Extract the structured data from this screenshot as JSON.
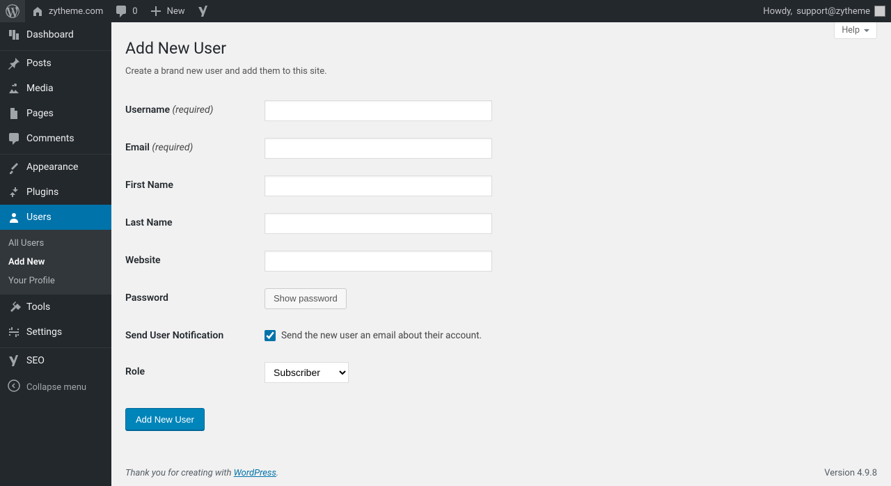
{
  "adminbar": {
    "site_name": "zytheme.com",
    "comments_count": "0",
    "new_label": "New",
    "howdy_prefix": "Howdy,",
    "user_name": "support@zytheme"
  },
  "sidebar": {
    "dashboard": "Dashboard",
    "posts": "Posts",
    "media": "Media",
    "pages": "Pages",
    "comments": "Comments",
    "appearance": "Appearance",
    "plugins": "Plugins",
    "users": "Users",
    "tools": "Tools",
    "settings": "Settings",
    "seo": "SEO",
    "collapse": "Collapse menu",
    "users_sub": {
      "all": "All Users",
      "add": "Add New",
      "profile": "Your Profile"
    }
  },
  "screen": {
    "help": "Help"
  },
  "page": {
    "title": "Add New User",
    "intro": "Create a brand new user and add them to this site."
  },
  "form": {
    "username": "Username",
    "email": "Email",
    "required": "(required)",
    "first_name": "First Name",
    "last_name": "Last Name",
    "website": "Website",
    "password": "Password",
    "show_password": "Show password",
    "notification": "Send User Notification",
    "notification_desc": "Send the new user an email about their account.",
    "role": "Role",
    "role_value": "Subscriber",
    "submit": "Add New User"
  },
  "footer": {
    "thanks_pre": "Thank you for creating with ",
    "wp": "WordPress",
    "period": ".",
    "version": "Version 4.9.8"
  }
}
